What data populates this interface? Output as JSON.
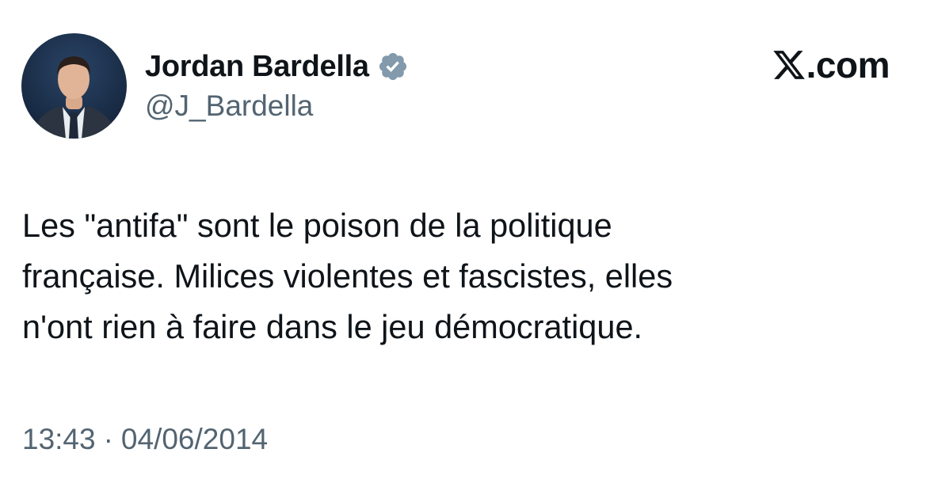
{
  "author": {
    "name": "Jordan Bardella",
    "handle": "@J_Bardella",
    "verified_icon": "verified-badge",
    "verified_color": "#829aab"
  },
  "site": {
    "logo_icon": "x-logo",
    "suffix": ".com"
  },
  "tweet": {
    "lines": [
      "Les \"antifa\" sont le poison de la politique",
      "française. Milices violentes et fascistes, elles",
      "n'ont rien à faire dans le jeu démocratique."
    ]
  },
  "meta": {
    "time": "13:43",
    "separator": "·",
    "date": "04/06/2014"
  },
  "colors": {
    "text": "#0f1419",
    "secondary": "#536471",
    "avatar_bg": "#1b2c44"
  }
}
